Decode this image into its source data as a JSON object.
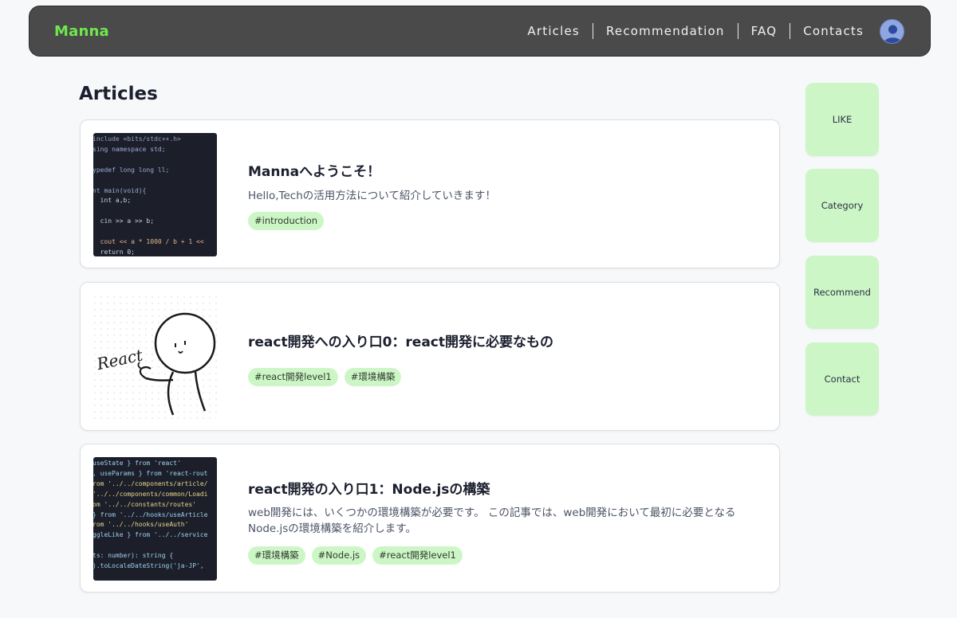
{
  "header": {
    "logo": "Manna",
    "nav": [
      "Articles",
      "Recommendation",
      "FAQ",
      "Contacts"
    ],
    "avatar_icon": "user-avatar-icon"
  },
  "page_title": "Articles",
  "articles": [
    {
      "title": "Mannaへようこそ！",
      "description": "Hello,Techの活用方法について紹介していきます！",
      "tags": [
        "#introduction"
      ],
      "thumbnail": {
        "type": "code",
        "lines": [
          "include <bits/stdc++.h>",
          "sing namespace std;",
          "",
          "ypedef long long ll;",
          "",
          "nt main(void){",
          "  int a,b;",
          "",
          "  cin >> a >> b;",
          "",
          "  cout << a * 1000 / b + 1 <<",
          "  return 0;"
        ]
      }
    },
    {
      "title": "react開発への入り口0：react開発に必要なもの",
      "description": "",
      "tags": [
        "#react開発level1",
        "#環境構築"
      ],
      "thumbnail": {
        "type": "sketch",
        "caption": "React"
      }
    },
    {
      "title": "react開発の入り口1：Node.jsの構築",
      "description": "web開発には、いくつかの環境構築が必要です。 この記事では、web開発において最初に必要となる Node.jsの環境構築を紹介します。",
      "tags": [
        "#環境構築",
        "#Node.js",
        "#react開発level1"
      ],
      "thumbnail": {
        "type": "code",
        "lines": [
          "useState } from 'react'",
          ", useParams } from 'react-rout",
          "rom '../../components/article/",
          "'../../components/common/Loadi",
          "om '../../constants/routes'",
          "} from '../../hooks/useArticle",
          "rom '../../hooks/useAuth'",
          "ggleLike } from '../../service",
          "",
          "ts: number): string {",
          ").toLocaleDateString('ja-JP',"
        ]
      }
    }
  ],
  "side_buttons": [
    "LIKE",
    "Category",
    "Recommend",
    "Contact"
  ]
}
